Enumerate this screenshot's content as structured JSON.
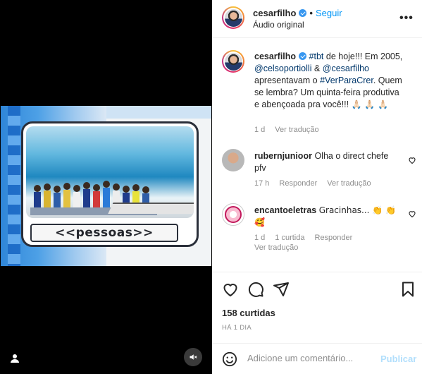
{
  "media": {
    "overlay_label": "<<pessoas>>",
    "user_icon": "user-icon",
    "sound_icon": "speaker-muted-icon"
  },
  "header": {
    "username": "cesarfilho",
    "separator": "•",
    "follow_label": "Seguir",
    "subtitle": "Áudio original",
    "more_label": "•••"
  },
  "caption": {
    "username": "cesarfilho",
    "text_parts": [
      "#tbt",
      " de hoje!!! Em 2005, ",
      "@celsoportiolli",
      " & ",
      "@cesarfilho",
      " apresentavam o ",
      "#VerParaCrer",
      ". Quem se lembra? Um quinta-feira produtiva e abençoada pra você!!! ",
      "🙏🏻 🙏🏻 🙏🏻"
    ],
    "time": "1 d",
    "translate_label": "Ver tradução"
  },
  "comments": [
    {
      "username": "rubernjunioor",
      "text": "Olha o direct chefe pfv",
      "time": "17 h",
      "reply_label": "Responder",
      "translate_label": "Ver tradução"
    },
    {
      "username": "encantoeletras",
      "text": "Gracinhas... 👏 👏 🥰",
      "time": "1 d",
      "likes": "1 curtida",
      "reply_label": "Responder",
      "translate_label": "Ver tradução"
    }
  ],
  "actions": {
    "likes": "158 curtidas",
    "posted_ago": "HÁ 1 DIA"
  },
  "add_comment": {
    "placeholder": "Adicione um comentário...",
    "publish_label": "Publicar"
  },
  "colors": {
    "link": "#00376b",
    "follow": "#0095f6",
    "verified": "#3897f0",
    "publish_disabled": "#b2dffc",
    "muted_text": "#8e8e8e"
  }
}
